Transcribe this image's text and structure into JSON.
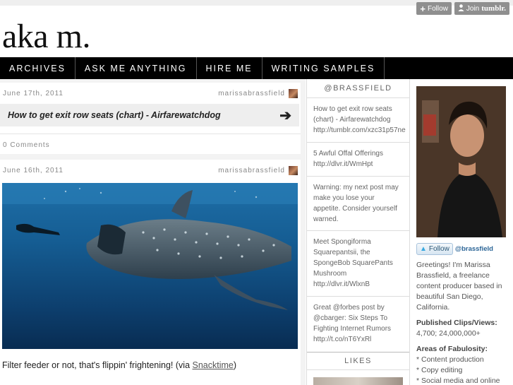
{
  "tumblr": {
    "follow_label": "Follow",
    "join_label": "Join",
    "join_brand": "tumblr."
  },
  "blog": {
    "title": "aka m."
  },
  "nav": [
    {
      "label": "ARCHIVES"
    },
    {
      "label": "ASK ME ANYTHING"
    },
    {
      "label": "HIRE ME"
    },
    {
      "label": "WRITING SAMPLES"
    }
  ],
  "posts": [
    {
      "date": "June 17th, 2011",
      "author": "marissabrassfield",
      "link_title": "How to get exit row seats (chart) - Airfarewatchdog",
      "comments": "0 Comments"
    },
    {
      "date": "June 16th, 2011",
      "author": "marissabrassfield",
      "caption_prefix": "Filter feeder or not, that's flippin' frightening! (via ",
      "caption_link": "Snacktime",
      "caption_suffix": ")"
    }
  ],
  "twitter": {
    "header": "@BRASSFIELD",
    "tweets": [
      "How to get exit row seats (chart) - Airfarewatchdog http://tumblr.com/xzc31p57ne",
      "5 Awful Offal Offerings http://dlvr.it/WmHpt",
      "Warning: my next post may make you lose your appetite. Consider yourself warned.",
      "Meet Spongiforma Squarepantsii, the SpongeBob SquarePants Mushroom http://dlvr.it/WlxnB",
      "Great @forbes post by @cbarger: Six Steps To Fighting Internet Rumors http://t.co/nT6YxRl"
    ],
    "likes_header": "LIKES"
  },
  "about": {
    "follow_button": "Follow",
    "handle": "@brassfield",
    "intro": "Greetings! I'm Marissa Brassfield, a freelance content producer based in beautiful San Diego, California.",
    "clips_heading": "Published Clips/Views:",
    "clips_value": "4,700; 24,000,000+",
    "areas_heading": "Areas of Fabulosity:",
    "areas": [
      "* Content production",
      "* Copy editing",
      "* Social media and online"
    ]
  }
}
